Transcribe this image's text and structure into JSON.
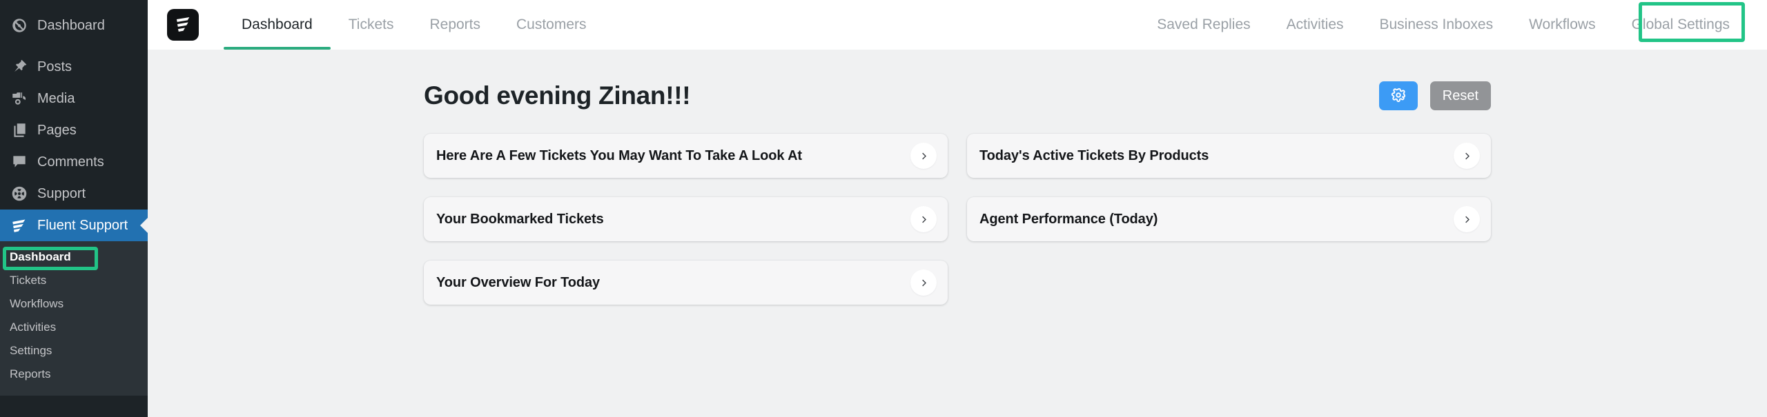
{
  "wp_sidebar": {
    "items": [
      {
        "label": "Dashboard",
        "icon": "gauge-icon",
        "current": false
      },
      {
        "label": "Posts",
        "icon": "pin-icon",
        "current": false
      },
      {
        "label": "Media",
        "icon": "media-camera-icon",
        "current": false
      },
      {
        "label": "Pages",
        "icon": "pages-icon",
        "current": false
      },
      {
        "label": "Comments",
        "icon": "comment-bubble-icon",
        "current": false
      },
      {
        "label": "Support",
        "icon": "lifebuoy-icon",
        "current": false
      },
      {
        "label": "Fluent Support",
        "icon": "fluent-support-icon",
        "current": true
      }
    ],
    "submenu": [
      {
        "label": "Dashboard",
        "active": true
      },
      {
        "label": "Tickets",
        "active": false
      },
      {
        "label": "Workflows",
        "active": false
      },
      {
        "label": "Activities",
        "active": false
      },
      {
        "label": "Settings",
        "active": false
      },
      {
        "label": "Reports",
        "active": false
      }
    ]
  },
  "appbar": {
    "logo_icon": "fluent-support-logo-icon",
    "nav_left": [
      {
        "label": "Dashboard",
        "active": true
      },
      {
        "label": "Tickets",
        "active": false
      },
      {
        "label": "Reports",
        "active": false
      },
      {
        "label": "Customers",
        "active": false
      }
    ],
    "nav_right": [
      {
        "label": "Saved Replies",
        "active": false
      },
      {
        "label": "Activities",
        "active": false
      },
      {
        "label": "Business Inboxes",
        "active": false
      },
      {
        "label": "Workflows",
        "active": false
      },
      {
        "label": "Global Settings",
        "active": false
      }
    ]
  },
  "page": {
    "greeting": "Good evening Zinan!!!",
    "settings_button_icon": "gear-icon",
    "reset_button_label": "Reset"
  },
  "cards": {
    "left_column": [
      {
        "title": "Here Are A Few Tickets You May Want To Take A Look At",
        "arrow_icon": "chevron-right-icon"
      },
      {
        "title": "Your Bookmarked Tickets",
        "arrow_icon": "chevron-right-icon"
      },
      {
        "title": "Your Overview For Today",
        "arrow_icon": "chevron-right-icon"
      }
    ],
    "right_column": [
      {
        "title": "Today's Active Tickets By Products",
        "arrow_icon": "chevron-right-icon"
      },
      {
        "title": "Agent Performance (Today)",
        "arrow_icon": "chevron-right-icon"
      }
    ]
  },
  "annotations": {
    "highlight_color": "#22c487",
    "boxes": [
      {
        "target": "sidebar-item-fluent-support-dashboard"
      },
      {
        "target": "nav-item-global-settings"
      }
    ]
  },
  "colors": {
    "sidebar_bg": "#1d2327",
    "submenu_bg": "#2c3338",
    "current_menu_bg": "#2271b1",
    "accent_green": "#2bab7f",
    "primary_blue": "#3c9bf5",
    "reset_gray": "#929497",
    "page_bg": "#f0f1f2"
  }
}
